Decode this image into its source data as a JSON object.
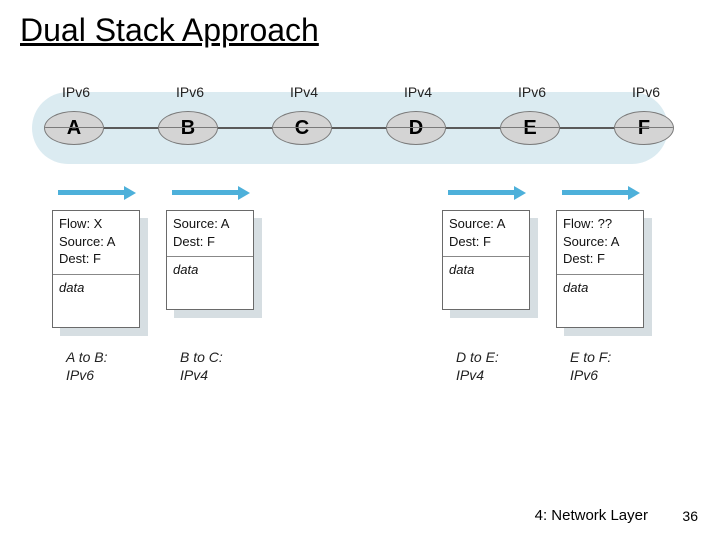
{
  "title": "Dual Stack Approach",
  "nodes": [
    {
      "letter": "A",
      "proto": "IPv6"
    },
    {
      "letter": "B",
      "proto": "IPv6"
    },
    {
      "letter": "C",
      "proto": "IPv4"
    },
    {
      "letter": "D",
      "proto": "IPv4"
    },
    {
      "letter": "E",
      "proto": "IPv6"
    },
    {
      "letter": "F",
      "proto": "IPv6"
    }
  ],
  "packets": [
    {
      "header_lines": [
        "Flow: X",
        "Source: A",
        "Dest: F"
      ],
      "payload": "data",
      "caption_top": "A to B:",
      "caption_bottom": "IPv6"
    },
    {
      "header_lines": [
        "Source: A",
        "Dest: F"
      ],
      "payload": "data",
      "caption_top": "B to C:",
      "caption_bottom": "IPv4"
    },
    {
      "header_lines": [
        "Source: A",
        "Dest: F"
      ],
      "payload": "data",
      "caption_top": "D to E:",
      "caption_bottom": "IPv4"
    },
    {
      "header_lines": [
        "Flow: ??",
        "Source: A",
        "Dest: F"
      ],
      "payload": "data",
      "caption_top": "E to F:",
      "caption_bottom": "IPv6"
    }
  ],
  "footer": {
    "chapter": "4: Network Layer",
    "page": "36"
  }
}
